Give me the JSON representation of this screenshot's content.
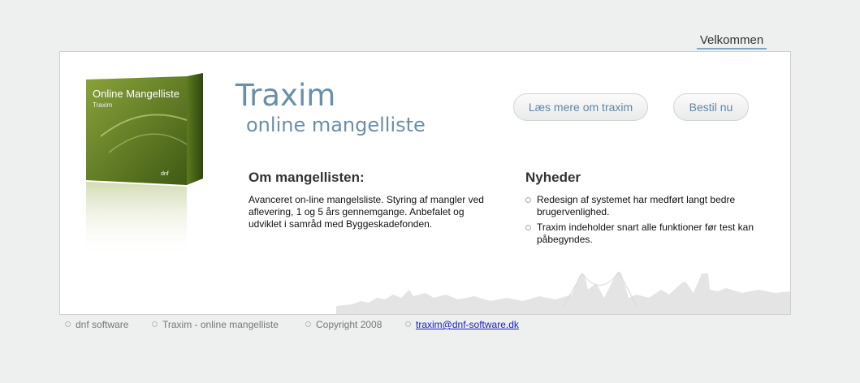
{
  "header": {
    "welcome_tab": "Velkommen"
  },
  "product_box": {
    "title": "Online Mangelliste",
    "subtitle": "Traxim",
    "brand": "dnf"
  },
  "hero": {
    "title": "Traxim",
    "subtitle": "online mangelliste",
    "buttons": {
      "read_more": "Læs mere om traxim",
      "order": "Bestil nu"
    }
  },
  "about": {
    "heading": "Om mangellisten:",
    "text": "Avanceret on-line mangelsliste. Styring af mangler ved aflevering, 1 og 5 års gennemgange. Anbefalet og udviklet i samråd med Byggeskadefonden."
  },
  "news": {
    "heading": "Nyheder",
    "items": [
      "Redesign af systemet har medført langt bedre brugervenlighed.",
      "Traxim indeholder snart alle funktioner før test kan påbegyndes."
    ]
  },
  "footer": {
    "items": [
      "dnf software",
      "Traxim - online mangelliste",
      "Copyright 2008"
    ],
    "email": "traxim@dnf-software.dk"
  },
  "colors": {
    "accent": "#6a8fa8",
    "box_green": "#5a7a1e"
  }
}
